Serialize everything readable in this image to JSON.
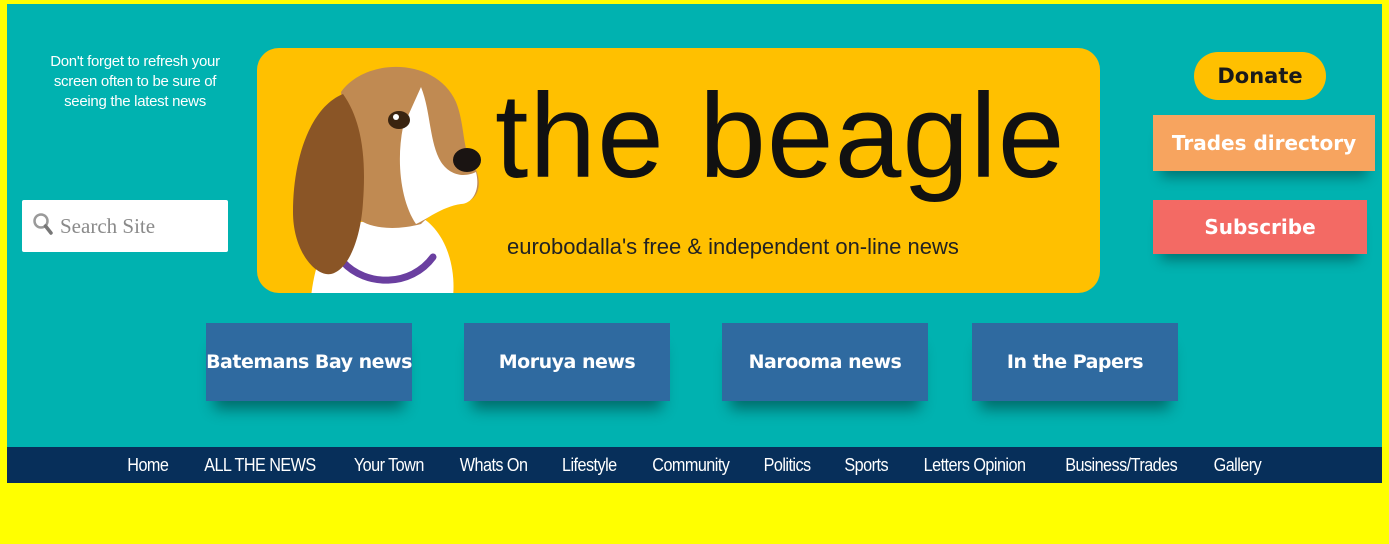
{
  "header": {
    "note": "Don't forget to refresh your screen often  to be sure of seeing the latest news",
    "search_placeholder": "Search Site"
  },
  "banner": {
    "title": "the beagle",
    "tagline": "eurobodalla's free & independent on-line news"
  },
  "side_buttons": {
    "donate": "Donate",
    "trades": "Trades directory",
    "subscribe": "Subscribe"
  },
  "town_buttons": [
    {
      "label": "Batemans Bay news"
    },
    {
      "label": "Moruya news"
    },
    {
      "label": "Narooma news"
    },
    {
      "label": "In the Papers"
    }
  ],
  "nav": {
    "items": [
      {
        "label": "Home"
      },
      {
        "label": "ALL THE NEWS"
      },
      {
        "label": "Your Town"
      },
      {
        "label": "Whats On"
      },
      {
        "label": "Lifestyle"
      },
      {
        "label": "Community"
      },
      {
        "label": "Politics"
      },
      {
        "label": "Sports"
      },
      {
        "label": "Letters Opinion"
      },
      {
        "label": "Business/Trades"
      },
      {
        "label": "Gallery"
      }
    ]
  },
  "colors": {
    "page_bg": "#ffff00",
    "header_bg": "#00b2b0",
    "banner_bg": "#ffc000",
    "town_button": "#2f6aa0",
    "nav_bg": "#072f5a",
    "trades_button": "#f7a45f",
    "subscribe_button": "#f36a64"
  },
  "icons": {
    "search": "magnifier-icon",
    "logo": "beagle-dog-icon"
  }
}
